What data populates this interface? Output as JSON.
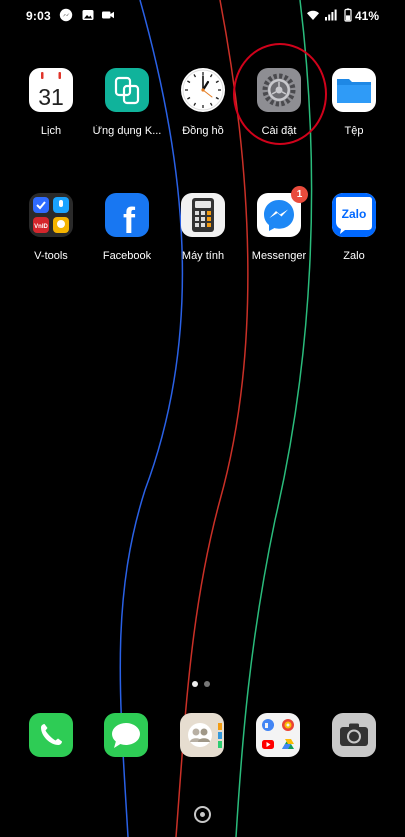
{
  "status_bar": {
    "time": "9:03",
    "battery_percent": "41%",
    "notification_icons": [
      "messenger-icon",
      "gallery-icon",
      "video-icon"
    ],
    "system_icons": [
      "wifi-icon",
      "signal-icon",
      "battery-icon"
    ]
  },
  "home_screen": {
    "rows": [
      [
        {
          "label": "Lịch",
          "icon": "calendar-icon",
          "calendar_day": "31"
        },
        {
          "label": "Ứng dụng K...",
          "icon": "app-k-icon"
        },
        {
          "label": "Đồng hồ",
          "icon": "clock-icon"
        },
        {
          "label": "Cài đặt",
          "icon": "settings-gear-icon",
          "highlighted": true
        },
        {
          "label": "Tệp",
          "icon": "files-folder-icon"
        }
      ],
      [
        {
          "label": "V-tools",
          "icon": "vtools-folder-icon",
          "folder_text": "VnID"
        },
        {
          "label": "Facebook",
          "icon": "facebook-icon",
          "glyph": "f"
        },
        {
          "label": "Máy tính",
          "icon": "calculator-icon"
        },
        {
          "label": "Messenger",
          "icon": "messenger-icon",
          "badge": "1"
        },
        {
          "label": "Zalo",
          "icon": "zalo-icon",
          "glyph": "Zalo"
        }
      ]
    ],
    "highlight_color": "#d0021b"
  },
  "page_indicator": {
    "current_page": 1,
    "total_pages": 2
  },
  "dock": [
    {
      "icon": "phone-icon"
    },
    {
      "icon": "messages-icon"
    },
    {
      "icon": "contacts-icon"
    },
    {
      "icon": "google-apps-folder-icon"
    },
    {
      "icon": "camera-icon"
    }
  ],
  "wallpaper": {
    "style": "black with blue, red and green curved lines",
    "colors": [
      "#000000",
      "#2f6bff",
      "#e0352b",
      "#2fd08a"
    ]
  }
}
